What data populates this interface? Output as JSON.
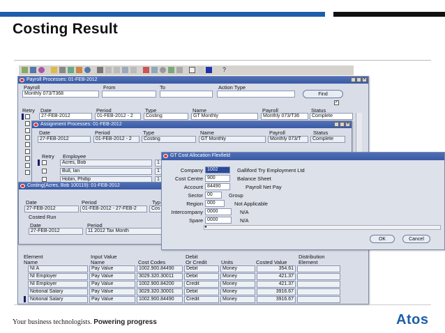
{
  "slide": {
    "title": "Costing Result",
    "footer_plain": "Your business technologists.",
    "footer_bold": "Powering progress",
    "logo": "Atos"
  },
  "colors": {
    "accent_blue": "#1c5eaa",
    "window_title": "#3a5aa4",
    "form_bg": "#d9dde8"
  },
  "toolbar": {
    "icons": [
      "open-icon",
      "save-icon",
      "print-icon",
      "cut-icon",
      "copy-icon",
      "paste-icon",
      "find-icon",
      "attach-icon",
      "help-icon"
    ]
  },
  "payroll_window": {
    "title": "Payroll Processes: 01-FEB-2012",
    "labels": {
      "payroll": "Payroll",
      "from": "From",
      "to": "To",
      "action_type": "Action Type",
      "find": "Find"
    },
    "payroll_value": "Monthly 073/T368",
    "headers": {
      "retry": "Retry",
      "date": "Date",
      "period": "Period",
      "type": "Type",
      "name": "Name",
      "payroll": "Payroll",
      "status": "Status"
    },
    "row": {
      "date": "27-FEB-2012",
      "period": "01-FEB-2012 - 2",
      "type": "Costing",
      "name": "GT Monthly",
      "payroll": "Monthly 073/T36",
      "status": "Complete"
    }
  },
  "assignment_window": {
    "title": "Assignment Processes: 01-FEB-2012",
    "headers": {
      "date": "Date",
      "period": "Period",
      "type": "Type",
      "name": "Name",
      "payroll": "Payroll",
      "status": "Status"
    },
    "row": {
      "date": "27-FEB-2012",
      "period": "01-FEB-2012 - 2",
      "type": "Costing",
      "name": "GT Monthly",
      "payroll": "Monthly 073/T",
      "status": "Complete"
    },
    "emp_headers": {
      "retry": "Retry",
      "employee": "Employee"
    },
    "employees": [
      {
        "name": "Acres, Bob",
        "num": "1"
      },
      {
        "name": "Bull, Ian",
        "num": "1"
      },
      {
        "name": "Hobin, Phillip",
        "num": "1"
      }
    ]
  },
  "costing_window": {
    "title": "Costing(Acres, Bob 100119): 01-FEB-2012",
    "labels": {
      "date": "Date",
      "period": "Period",
      "type": "Typ",
      "costed_run": "Costed Run",
      "run_date": "Date",
      "run_period": "Period"
    },
    "date": "27-FEB-2012",
    "period": "01-FEB-2012 - 27-FEB-2",
    "type": "Cos",
    "run_date": "27-FEB-2012",
    "run_period": "11 2012 Tax Month",
    "table_headers": {
      "element": "Element",
      "element_name": "Name",
      "input_value": "Input Value",
      "input_value_name": "Name",
      "cost_codes": "Cost Codes",
      "debit": "Debit",
      "or_credit": "Or Credit",
      "units": "Units",
      "costed_value": "Costed Value",
      "distribution": "Distribution",
      "distribution_element": "Element"
    },
    "rows": [
      {
        "element": "NI A",
        "input": "Pay Value",
        "code": "1002.900.84490",
        "dc": "Debit",
        "units": "Money",
        "value": "354.61"
      },
      {
        "element": "NI Employer",
        "input": "Pay Value",
        "code": "3029.320.30011",
        "dc": "Debit",
        "units": "Money",
        "value": "421.37"
      },
      {
        "element": "NI Employer",
        "input": "Pay Value",
        "code": "1002.900.84200",
        "dc": "Credit",
        "units": "Money",
        "value": "421.37"
      },
      {
        "element": "Notional Salary",
        "input": "Pay Value",
        "code": "3029.320.30001",
        "dc": "Debit",
        "units": "Money",
        "value": "3916.67"
      },
      {
        "element": "Notional Salary",
        "input": "Pay Value",
        "code": "1002.900.84490",
        "dc": "Credit",
        "units": "Money",
        "value": "3916.67"
      }
    ]
  },
  "flexfield_window": {
    "title": "GT Cost Allocation Flexfield",
    "segments": [
      {
        "label": "Company",
        "value": "1002",
        "desc": "Galliford Try Employment Ltd"
      },
      {
        "label": "Cost Centre",
        "value": "900",
        "desc": "Balance Sheet"
      },
      {
        "label": "Account",
        "value": "84490",
        "desc": "Payroll Net Pay"
      },
      {
        "label": "Sector",
        "value": "00",
        "desc": "Group"
      },
      {
        "label": "Region",
        "value": "000",
        "desc": "Not Applicable"
      },
      {
        "label": "Intercompany",
        "value": "0000",
        "desc": "N/A"
      },
      {
        "label": "Spare",
        "value": "0000",
        "desc": "N/A"
      }
    ],
    "ok": "OK",
    "cancel": "Cancel"
  }
}
